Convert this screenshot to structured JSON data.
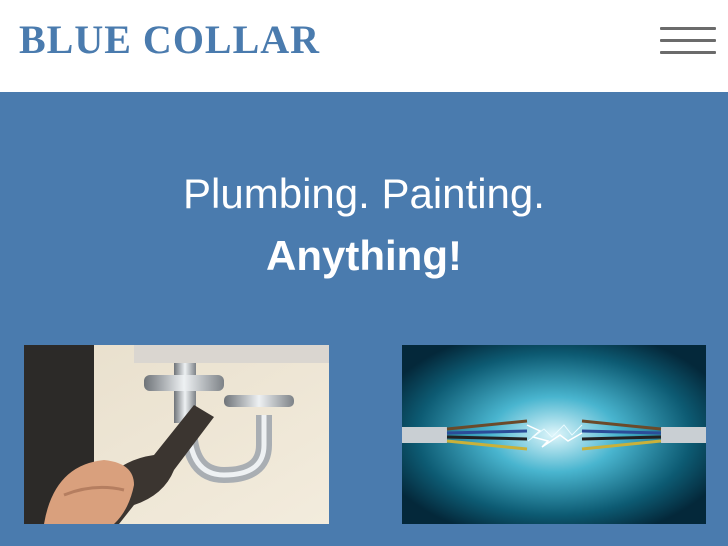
{
  "header": {
    "brand": "BLUE COLLAR",
    "menu_icon": "hamburger-menu-icon"
  },
  "hero": {
    "line1": "Plumbing. Painting.",
    "line2": "Anything!"
  },
  "colors": {
    "brand": "#4a7bae",
    "hero_bg": "#4a7bae",
    "header_bg": "#ffffff",
    "menu_icon": "#6b6b6b",
    "headline": "#ffffff"
  }
}
